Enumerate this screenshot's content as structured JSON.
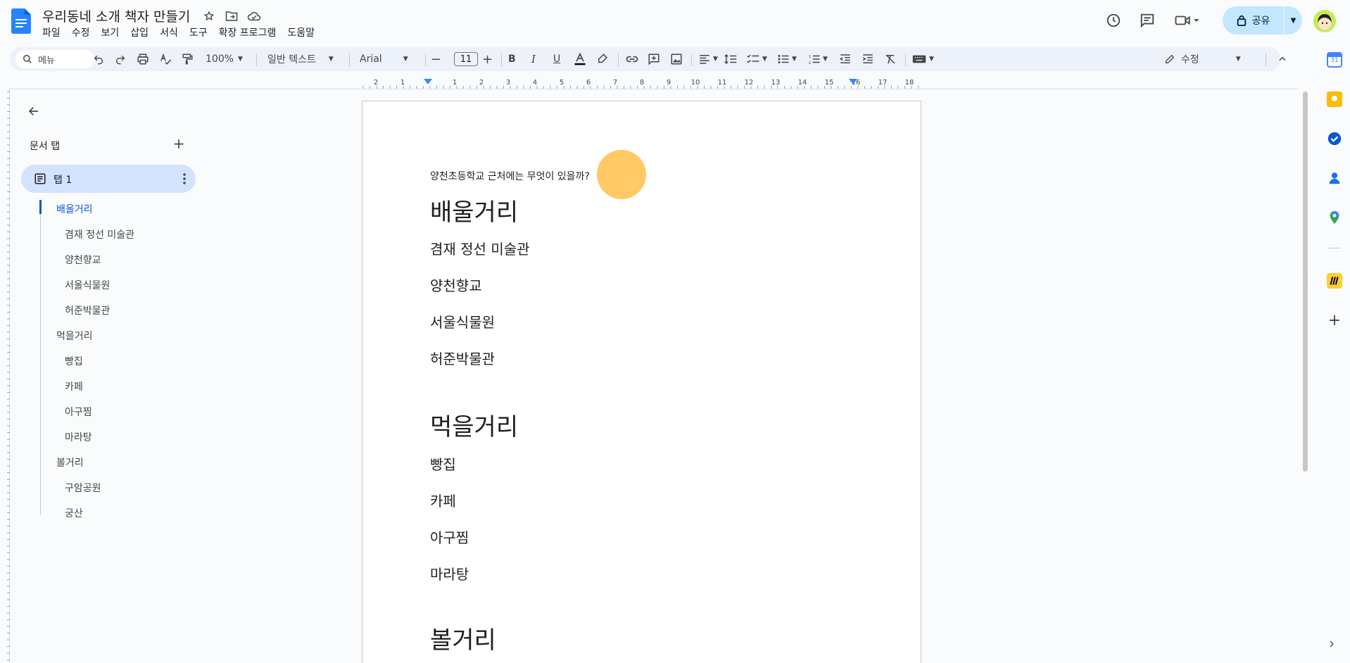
{
  "document": {
    "title": "우리동네 소개 책자 만들기"
  },
  "menu": [
    "파일",
    "수정",
    "보기",
    "삽입",
    "서식",
    "도구",
    "확장 프로그램",
    "도움말"
  ],
  "share": {
    "label": "공유"
  },
  "toolbar": {
    "search_label": "메뉴",
    "zoom": "100%",
    "style": "일반 텍스트",
    "font": "Arial",
    "font_size": "11",
    "mode": "수정"
  },
  "ruler": {
    "ticks": [
      "2",
      "1",
      "1",
      "2",
      "3",
      "4",
      "5",
      "6",
      "7",
      "8",
      "9",
      "10",
      "11",
      "12",
      "13",
      "14",
      "15",
      "16",
      "17",
      "18"
    ]
  },
  "outline": {
    "tabs_header": "문서 탭",
    "tab_label": "탭 1",
    "items": [
      {
        "label": "배울거리",
        "level": 2,
        "active": true
      },
      {
        "label": "겸재 정선 미술관",
        "level": 3
      },
      {
        "label": "양천향교",
        "level": 3
      },
      {
        "label": "서울식물원",
        "level": 3
      },
      {
        "label": "허준박물관",
        "level": 3
      },
      {
        "label": "먹을거리",
        "level": 2
      },
      {
        "label": "빵집",
        "level": 3
      },
      {
        "label": "카페",
        "level": 3
      },
      {
        "label": "아구찜",
        "level": 3
      },
      {
        "label": "마라탕",
        "level": 3
      },
      {
        "label": "볼거리",
        "level": 2
      },
      {
        "label": "구암공원",
        "level": 3
      },
      {
        "label": "궁산",
        "level": 3
      }
    ]
  },
  "page": {
    "intro": "양천초등학교 근처에는 무엇이 있을까?",
    "lines": [
      {
        "text": "배울거리",
        "kind": "h1"
      },
      {
        "text": "겸재 정선 미술관",
        "kind": "h2"
      },
      {
        "text": "양천향교",
        "kind": "h2"
      },
      {
        "text": "서울식물원",
        "kind": "h2"
      },
      {
        "text": "허준박물관",
        "kind": "h2"
      },
      {
        "text": "먹을거리",
        "kind": "h1"
      },
      {
        "text": "빵집",
        "kind": "h2"
      },
      {
        "text": "카페",
        "kind": "h2"
      },
      {
        "text": "아구찜",
        "kind": "h2"
      },
      {
        "text": "마라탕",
        "kind": "h2"
      },
      {
        "text": "볼거리",
        "kind": "h1"
      }
    ]
  },
  "colors": {
    "accent": "#0b57d0",
    "share_bg": "#c2e7ff",
    "tab_bg": "#d3e3fd",
    "cursor_highlight": "#ffb732"
  }
}
